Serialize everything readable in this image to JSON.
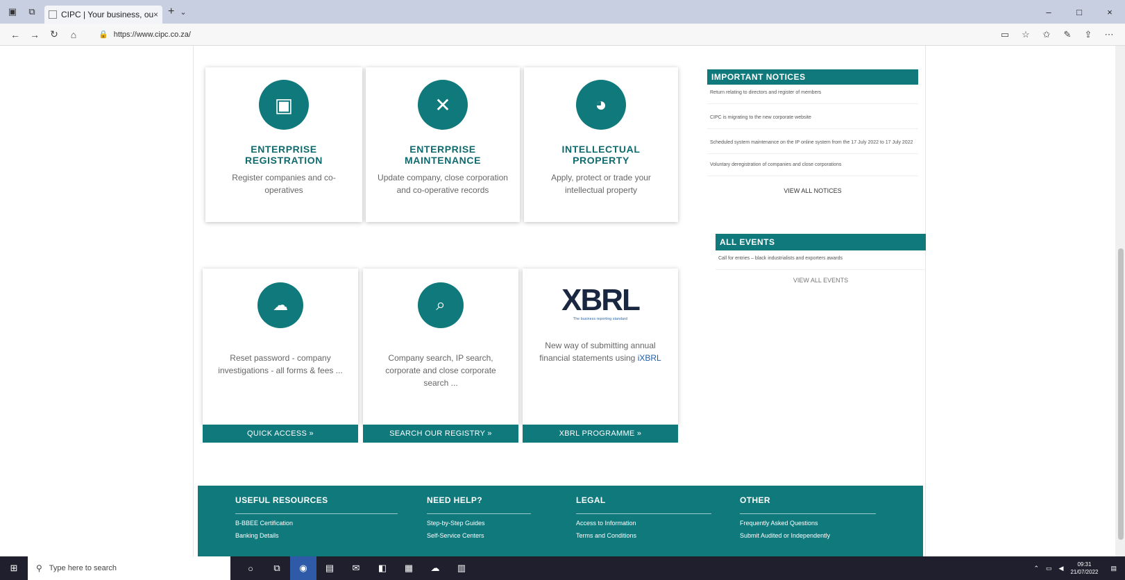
{
  "browser": {
    "tab_title": "CIPC | Your business, ou",
    "tab_close": "×",
    "new_tab": "+",
    "tab_dropdown": "⌄",
    "url": "https://www.cipc.co.za/",
    "window_controls": [
      "–",
      "□",
      "×"
    ]
  },
  "cards_top": [
    {
      "icon": "id-card-icon",
      "title_line1": "ENTERPRISE",
      "title_line2": "REGISTRATION",
      "description": "Register companies and co-operatives"
    },
    {
      "icon": "tools-icon",
      "title_line1": "ENTERPRISE",
      "title_line2": "MAINTENANCE",
      "description": "Update company, close corporation and co-operative records"
    },
    {
      "icon": "globe-icon",
      "title_line1": "INTELLECTUAL",
      "title_line2": "PROPERTY",
      "description": "Apply, protect or trade your intellectual property"
    }
  ],
  "cards_bottom": [
    {
      "icon": "cloud-sync-icon",
      "description": "Reset password - company investigations - all forms & fees ...",
      "cta": "QUICK ACCESS »"
    },
    {
      "icon": "search-icon",
      "description": "Company search, IP search, corporate and close corporate search ...",
      "cta": "SEARCH OUR REGISTRY »"
    },
    {
      "logo_text": "XBRL",
      "logo_tagline": "The business reporting standard",
      "description_prefix": "New way of submitting annual financial statements using ",
      "description_link": "iXBRL",
      "cta": "XBRL PROGRAMME »"
    }
  ],
  "notices": {
    "title": "IMPORTANT NOTICES",
    "items": [
      "Return relating to directors and register of members",
      "CIPC is migrating to the new corporate website",
      "Scheduled system maintenance on the IP online system from the 17 July 2022 to 17 July 2022",
      "Voluntary deregistration of companies and close corporations"
    ],
    "view_all": "VIEW ALL NOTICES"
  },
  "events": {
    "title": "ALL EVENTS",
    "items": [
      "Call for entries – black industrialists and exporters awards"
    ],
    "view_all": "VIEW ALL EVENTS"
  },
  "footer": {
    "columns": [
      {
        "heading": "USEFUL RESOURCES",
        "links": [
          "B-BBEE Certification",
          "Banking Details"
        ]
      },
      {
        "heading": "NEED HELP?",
        "links": [
          "Step-by-Step Guides",
          "Self-Service Centers"
        ]
      },
      {
        "heading": "LEGAL",
        "links": [
          "Access to Information",
          "Terms and Conditions"
        ]
      },
      {
        "heading": "OTHER",
        "links": [
          "Frequently Asked Questions",
          "Submit Audited or Independently"
        ]
      }
    ]
  },
  "taskbar": {
    "search_placeholder": "Type here to search",
    "time": "09:31",
    "date": "21/07/2022"
  },
  "colors": {
    "teal": "#10797c"
  }
}
